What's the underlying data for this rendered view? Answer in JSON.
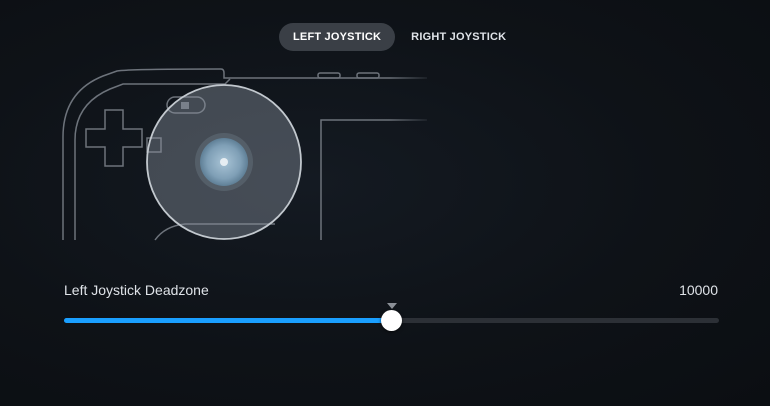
{
  "tabs": [
    {
      "label": "LEFT JOYSTICK",
      "active": true
    },
    {
      "label": "RIGHT JOYSTICK",
      "active": false
    }
  ],
  "controller": {
    "illustration_icon": "controller-left-half-icon",
    "joystick_icon": "joystick-icon"
  },
  "deadzone": {
    "label": "Left Joystick Deadzone",
    "value_text": "10000",
    "fraction": 0.5,
    "default_fraction": 0.5
  },
  "colors": {
    "accent": "#1a9fff",
    "track": "#2c3036",
    "active_tab_bg": "#3a3f46",
    "text": "#dfe3e8"
  }
}
